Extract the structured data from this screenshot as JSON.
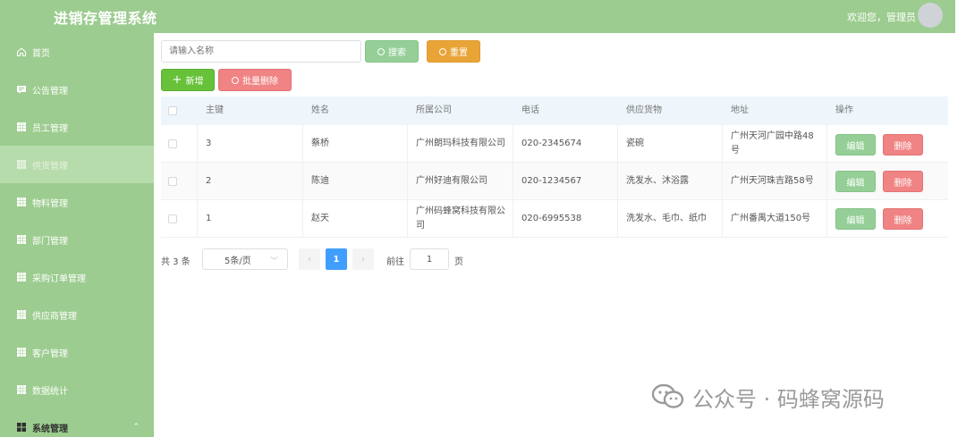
{
  "header": {
    "app_title": "进销存管理系统",
    "welcome": "欢迎您，管理员"
  },
  "sidebar": {
    "items": [
      {
        "label": "首页",
        "icon": "home-icon"
      },
      {
        "label": "公告管理",
        "icon": "message-icon"
      },
      {
        "label": "员工管理",
        "icon": "grid-icon"
      },
      {
        "label": "供货管理",
        "icon": "grid-icon",
        "active": true
      },
      {
        "label": "物料管理",
        "icon": "grid-icon"
      },
      {
        "label": "部门管理",
        "icon": "grid-icon"
      },
      {
        "label": "采购订单管理",
        "icon": "grid-icon"
      },
      {
        "label": "供应商管理",
        "icon": "grid-icon"
      },
      {
        "label": "客户管理",
        "icon": "grid-icon"
      },
      {
        "label": "数据统计",
        "icon": "grid-icon"
      },
      {
        "label": "系统管理",
        "icon": "apps-icon",
        "expanded": true
      }
    ]
  },
  "toolbar": {
    "search_placeholder": "请输入名称",
    "search_label": "搜索",
    "reset_label": "重置",
    "add_label": "新增",
    "batch_delete_label": "批量删除"
  },
  "table": {
    "headers": [
      "主键",
      "姓名",
      "所属公司",
      "电话",
      "供应货物",
      "地址",
      "操作"
    ],
    "rows": [
      {
        "id": "3",
        "name": "蔡桥",
        "company": "广州朗玛科技有限公司",
        "phone": "020-2345674",
        "goods": "瓷碗",
        "address": "广州天河广园中路48号"
      },
      {
        "id": "2",
        "name": "陈迪",
        "company": "广州好迪有限公司",
        "phone": "020-1234567",
        "goods": "洗发水、沐浴露",
        "address": "广州天河珠吉路58号"
      },
      {
        "id": "1",
        "name": "赵天",
        "company": "广州码蜂窝科技有限公司",
        "phone": "020-6995538",
        "goods": "洗发水、毛巾、纸巾",
        "address": "广州番禺大道150号"
      }
    ],
    "edit_label": "编辑",
    "delete_label": "删除"
  },
  "pagination": {
    "total_text": "共 3 条",
    "page_size": "5条/页",
    "current_page": "1",
    "goto_label": "前往",
    "goto_value": "1",
    "page_unit": "页"
  },
  "watermark": {
    "text": "公众号 · 码蜂窝源码"
  },
  "colors": {
    "header_bg": "#9ccc8f",
    "sidebar_bg": "#9ccc8f",
    "primary_green": "#67c23a",
    "search_green": "#95cf97",
    "reset_orange": "#e9a437",
    "danger_red": "#f08383",
    "page_blue": "#409eff"
  }
}
